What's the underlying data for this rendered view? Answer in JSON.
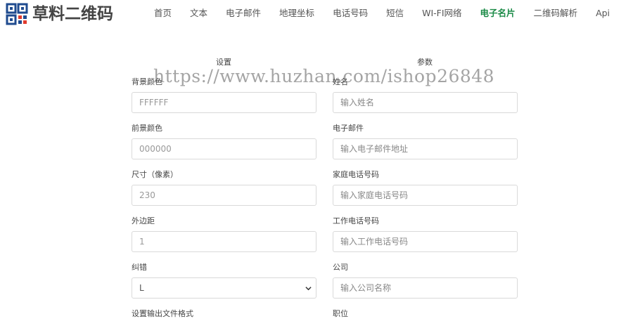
{
  "logo": {
    "text": "草料二维码"
  },
  "nav": {
    "items": [
      {
        "label": "首页"
      },
      {
        "label": "文本"
      },
      {
        "label": "电子邮件"
      },
      {
        "label": "地理坐标"
      },
      {
        "label": "电话号码"
      },
      {
        "label": "短信"
      },
      {
        "label": "WI-FI网络"
      },
      {
        "label": "电子名片"
      },
      {
        "label": "二维码解析"
      },
      {
        "label": "Api"
      }
    ],
    "active_index": 7,
    "active_color": "#1a8a46"
  },
  "settings": {
    "title": "设置",
    "fields": [
      {
        "label": "背景颜色",
        "value": "FFFFFF"
      },
      {
        "label": "前景颜色",
        "value": "000000"
      },
      {
        "label": "尺寸（像素）",
        "value": "230"
      },
      {
        "label": "外边距",
        "value": "1"
      },
      {
        "label": "纠错",
        "value": "L"
      },
      {
        "label": "设置输出文件格式"
      }
    ]
  },
  "params": {
    "title": "参数",
    "fields": [
      {
        "label": "姓名",
        "placeholder": "输入姓名"
      },
      {
        "label": "电子邮件",
        "placeholder": "输入电子邮件地址"
      },
      {
        "label": "家庭电话号码",
        "placeholder": "输入家庭电话号码"
      },
      {
        "label": "工作电话号码",
        "placeholder": "输入工作电话号码"
      },
      {
        "label": "公司",
        "placeholder": "输入公司名称"
      },
      {
        "label": "职位"
      }
    ]
  },
  "watermark": "https://www.huzhan.com/ishop26848"
}
